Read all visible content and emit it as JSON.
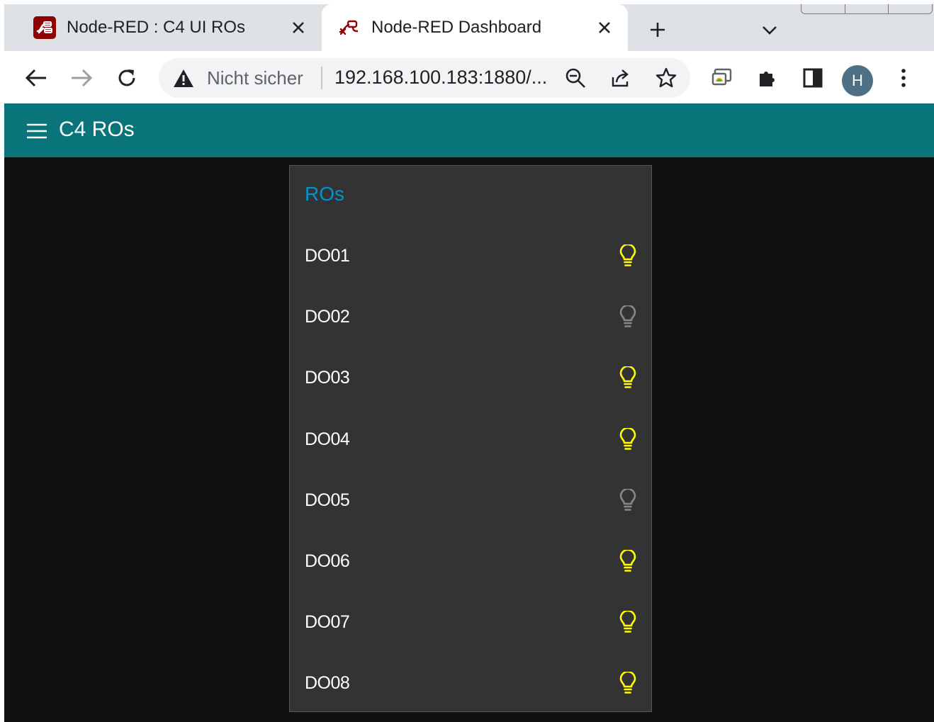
{
  "colors": {
    "accent_header": "#097479",
    "group_title": "#0094ce",
    "led_on": "#ffff00",
    "led_off": "#888888",
    "page_bg": "#111111",
    "group_bg": "#333333"
  },
  "browser": {
    "tabs": [
      {
        "title": "Node-RED : C4 UI ROs",
        "icon": "node-red-logo-icon",
        "active": false
      },
      {
        "title": "Node-RED Dashboard",
        "icon": "node-red-flow-icon",
        "active": true
      }
    ],
    "omnibox": {
      "security_label": "Nicht sicher",
      "url": "192.168.100.183:1880/..."
    },
    "profile_initial": "H"
  },
  "dashboard": {
    "title": "C4 ROs",
    "group": {
      "title": "ROs",
      "items": [
        {
          "label": "DO01",
          "state": "on"
        },
        {
          "label": "DO02",
          "state": "off"
        },
        {
          "label": "DO03",
          "state": "on"
        },
        {
          "label": "DO04",
          "state": "on"
        },
        {
          "label": "DO05",
          "state": "off"
        },
        {
          "label": "DO06",
          "state": "on"
        },
        {
          "label": "DO07",
          "state": "on"
        },
        {
          "label": "DO08",
          "state": "on"
        }
      ]
    }
  }
}
